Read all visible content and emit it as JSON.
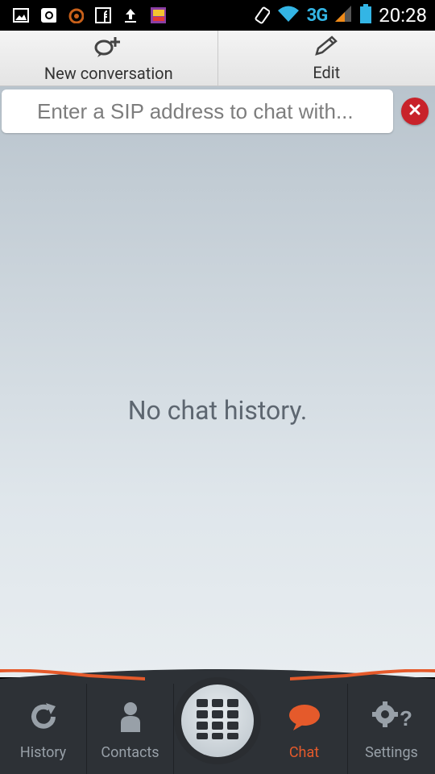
{
  "statusbar": {
    "icons_left": [
      "image-icon",
      "mail-icon",
      "weather-icon",
      "facebook-icon",
      "upload-icon",
      "game-icon"
    ],
    "network": "3G",
    "time": "20:28"
  },
  "toolbar": {
    "new_conversation_label": "New conversation",
    "edit_label": "Edit"
  },
  "search": {
    "placeholder": "Enter a SIP address to chat with..."
  },
  "main": {
    "empty_message": "No chat history."
  },
  "tabs": [
    {
      "label": "History",
      "icon": "history-icon"
    },
    {
      "label": "Contacts",
      "icon": "contacts-icon"
    },
    {
      "label": "",
      "icon": "dialer-icon"
    },
    {
      "label": "Chat",
      "icon": "chat-icon"
    },
    {
      "label": "Settings",
      "icon": "settings-icon"
    }
  ],
  "colors": {
    "accent": "#e55a2b",
    "clear_button": "#c8222a",
    "tab_inactive": "#98a0a8"
  }
}
